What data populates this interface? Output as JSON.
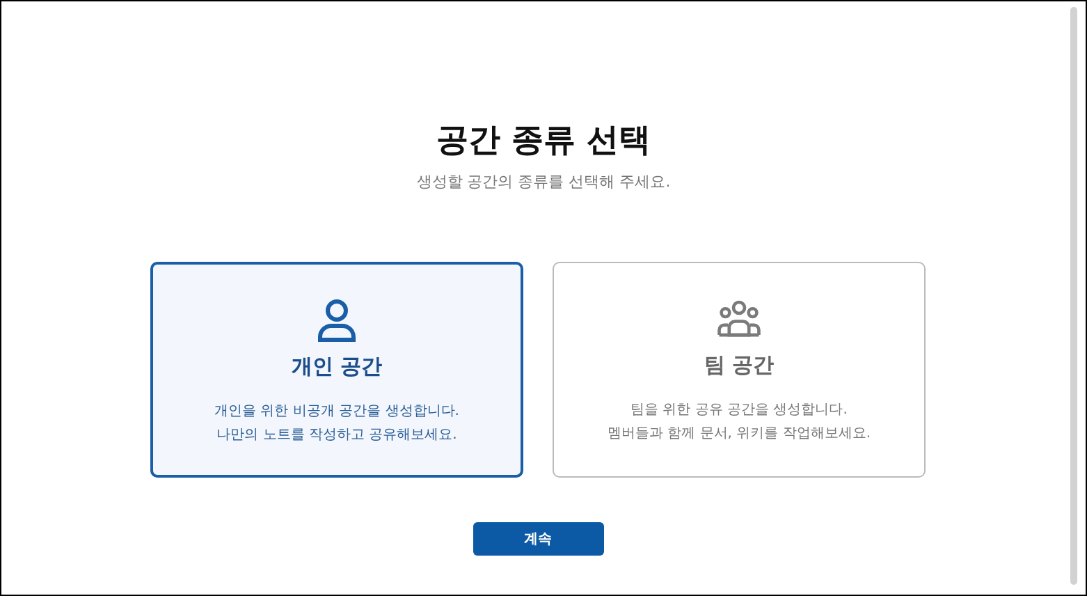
{
  "title": "공간 종류 선택",
  "subtitle": "생성할 공간의 종류를 선택해 주세요.",
  "options": [
    {
      "kind": "personal",
      "title": "개인 공간",
      "description": [
        "개인을 위한 비공개 공간을 생성합니다.",
        "나만의 노트를 작성하고 공유해보세요."
      ],
      "selected": true
    },
    {
      "kind": "team",
      "title": "팀 공간",
      "description": [
        "팀을 위한 공유 공간을 생성합니다.",
        "멤버들과 함께 문서, 위키를 작업해보세요."
      ],
      "selected": false
    }
  ],
  "continue_button": "계속"
}
